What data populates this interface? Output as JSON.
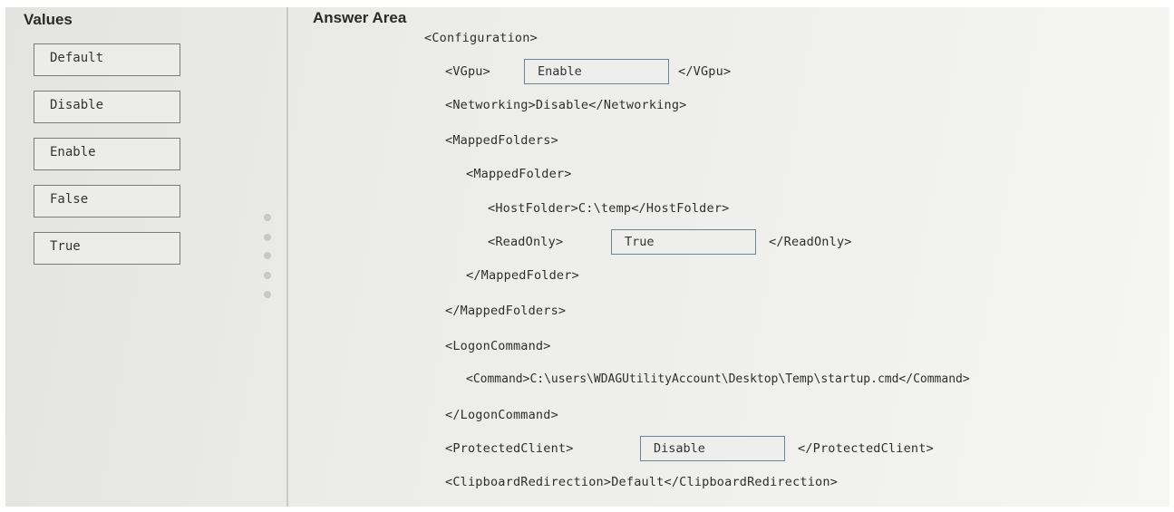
{
  "values_panel": {
    "title": "Values",
    "items": [
      "Default",
      "Disable",
      "Enable",
      "False",
      "True"
    ]
  },
  "answer_area": {
    "title": "Answer Area",
    "lines": {
      "configuration_open": "<Configuration>",
      "vgpu_open": "<VGpu>",
      "vgpu_value": "Enable",
      "vgpu_close": "</VGpu>",
      "networking": "<Networking>Disable</Networking>",
      "mapped_folders_open": "<MappedFolders>",
      "mapped_folder_open": "<MappedFolder>",
      "host_folder": "<HostFolder>C:\\temp</HostFolder>",
      "readonly_open": "<ReadOnly>",
      "readonly_value": "True",
      "readonly_close": "</ReadOnly>",
      "mapped_folder_close": "</MappedFolder>",
      "mapped_folders_close": "</MappedFolders>",
      "logon_command_open": "<LogonCommand>",
      "command": "<Command>C:\\users\\WDAGUtilityAccount\\Desktop\\Temp\\startup.cmd</Command>",
      "logon_command_close": "</LogonCommand>",
      "protected_client_open": "<ProtectedClient>",
      "protected_client_value": "Disable",
      "protected_client_close": "</ProtectedClient>",
      "clipboard_redirection": "<ClipboardRedirection>Default</ClipboardRedirection>"
    }
  }
}
